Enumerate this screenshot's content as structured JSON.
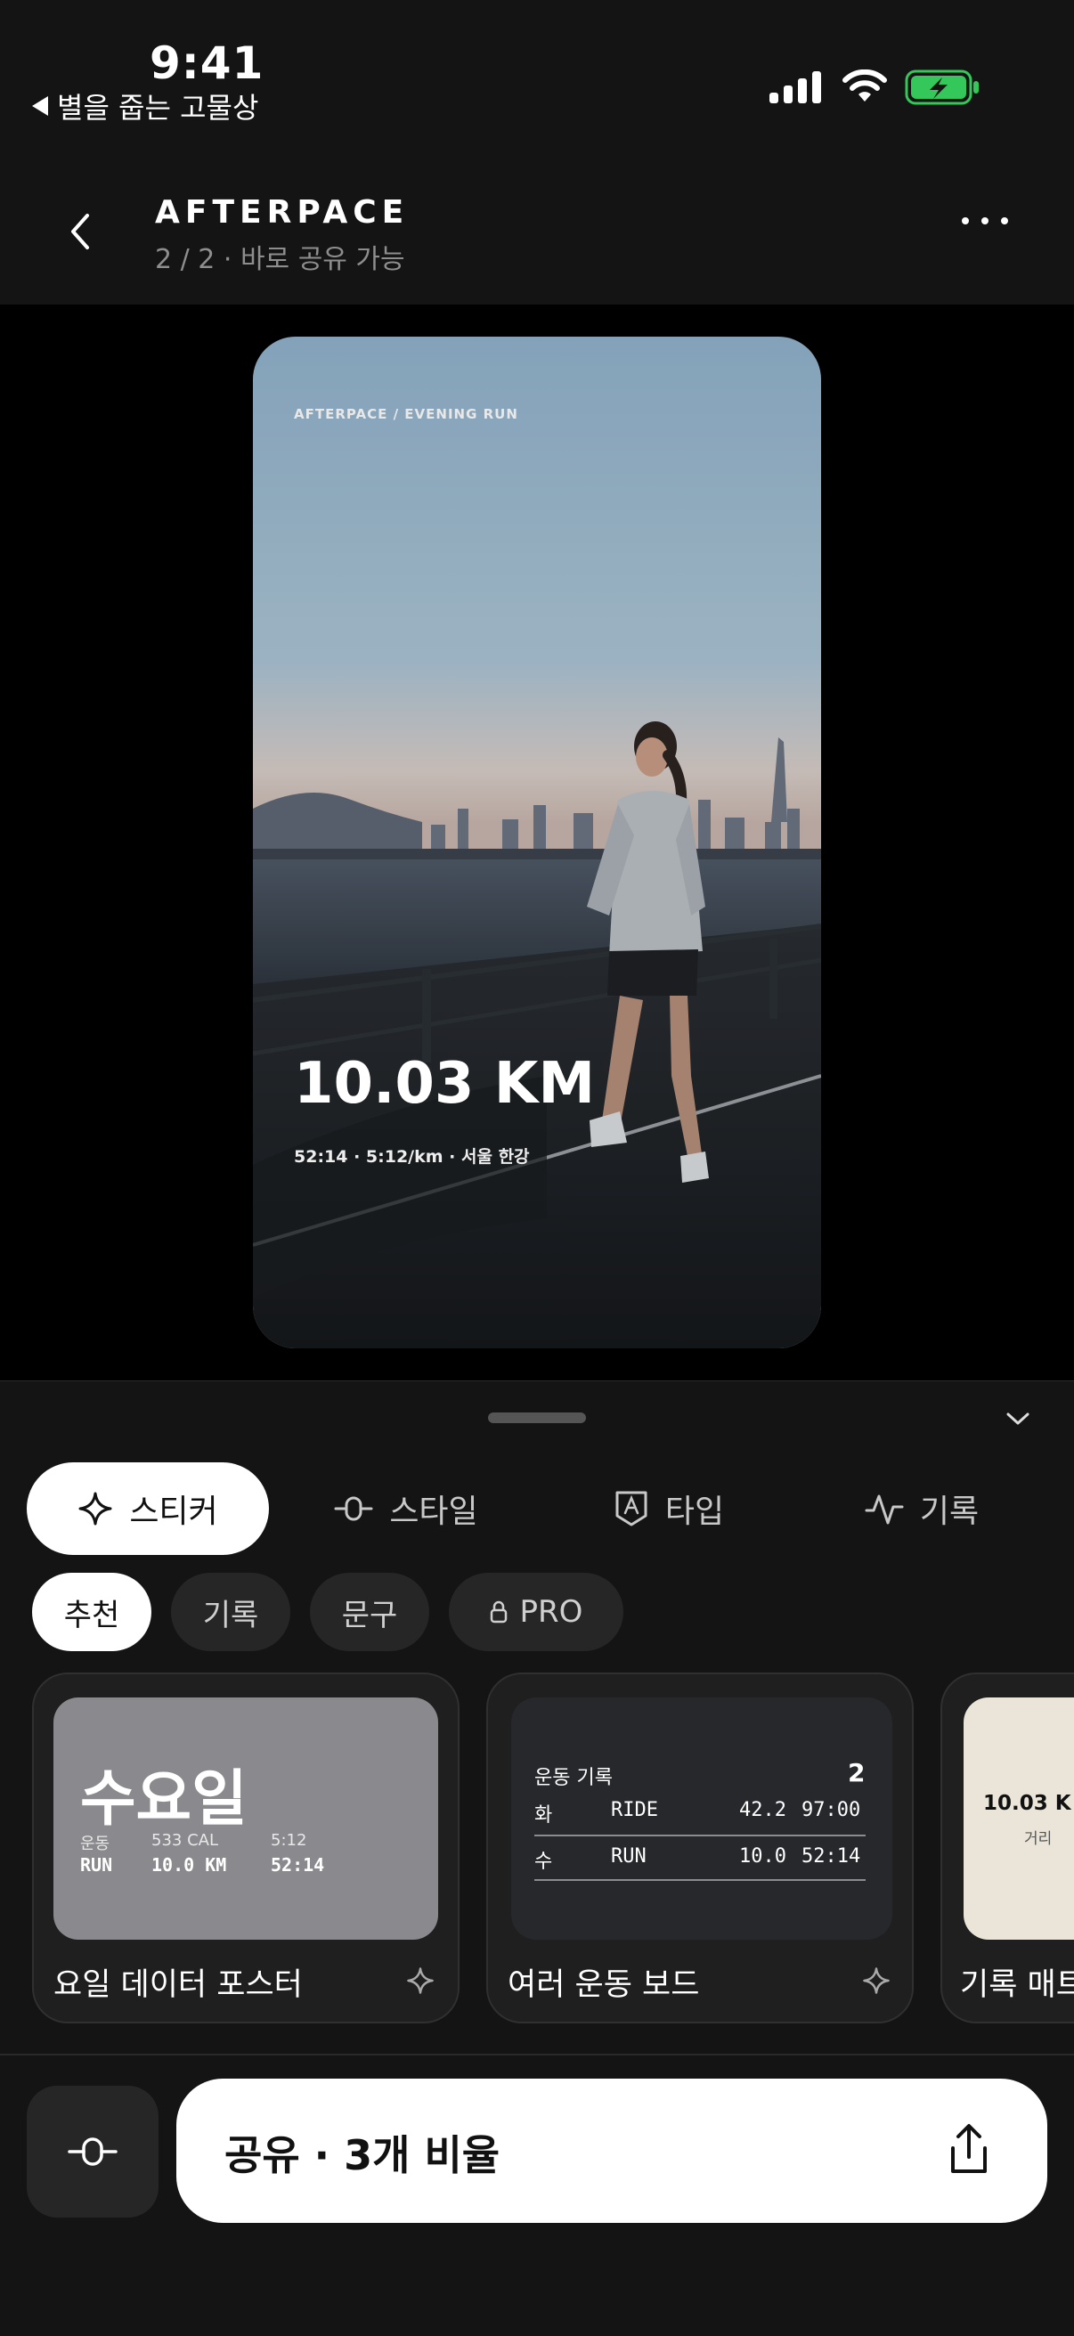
{
  "status_bar": {
    "time": "9:41",
    "back_app": "별을 줍는 고물상"
  },
  "header": {
    "title": "AFTERPACE",
    "subtitle": "2 / 2 · 바로 공유 가능"
  },
  "story": {
    "meta": "AFTERPACE  /  EVENING RUN",
    "distance": "10.03 KM",
    "stats": "52:14   ·   5:12/km   ·   서울 한강"
  },
  "tabs": [
    {
      "label": "스티커",
      "icon": "sparkle-icon",
      "active": true
    },
    {
      "label": "스타일",
      "icon": "style-slider-icon",
      "active": false
    },
    {
      "label": "타입",
      "icon": "type-badge-icon",
      "active": false
    },
    {
      "label": "기록",
      "icon": "activity-pulse-icon",
      "active": false
    }
  ],
  "chips": [
    {
      "label": "추천",
      "active": true
    },
    {
      "label": "기록",
      "active": false
    },
    {
      "label": "문구",
      "active": false
    },
    {
      "label": "PRO",
      "icon": "lock-icon",
      "active": false
    }
  ],
  "cards": {
    "poster": {
      "day": "수요일",
      "cols": [
        {
          "label": "운동",
          "value": "RUN"
        },
        {
          "label": "533 CAL",
          "value": "10.0 KM"
        },
        {
          "label": "5:12",
          "value": "52:14"
        }
      ],
      "title": "요일 데이터 포스터"
    },
    "board": {
      "heading": "운동 기록",
      "count": "2",
      "rows": [
        {
          "day": "화",
          "type": "RIDE",
          "dist": "42.2",
          "time": "97:00"
        },
        {
          "day": "수",
          "type": "RUN",
          "dist": "10.0",
          "time": "52:14"
        }
      ],
      "title": "여러 운동 보드"
    },
    "mat": {
      "value": "10.03 K",
      "caption": "거리",
      "title": "기록 매트"
    }
  },
  "footer": {
    "share_label": "공유 · 3개 비율"
  },
  "colors": {
    "background": "#141414",
    "battery": "#34c759",
    "accent": "#ffffff"
  }
}
